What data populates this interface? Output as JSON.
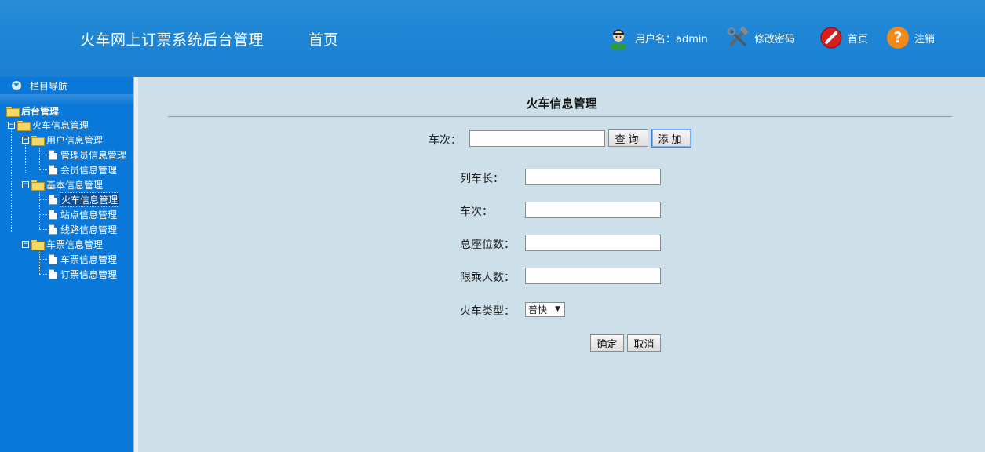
{
  "header": {
    "app_title": "火车网上订票系统后台管理",
    "home_nav": "首页",
    "user_label": "用户名：admin",
    "change_password": "修改密码",
    "home": "首页",
    "logout": "注销",
    "icons": {
      "user": "user-avatar-icon",
      "tools": "tools-icon",
      "home": "home-icon",
      "logout": "help-icon"
    }
  },
  "sidebar": {
    "nav_title": "栏目导航",
    "tree": {
      "root": "后台管理",
      "train_mgmt": "火车信息管理",
      "user_info": "用户信息管理",
      "admin_info": "管理员信息管理",
      "member_info": "会员信息管理",
      "basic_info": "基本信息管理",
      "train_info": "火车信息管理",
      "station_info": "站点信息管理",
      "route_info": "线路信息管理",
      "ticket_mgmt": "车票信息管理",
      "ticket_info": "车票信息管理",
      "order_info": "订票信息管理"
    }
  },
  "main": {
    "title": "火车信息管理",
    "search": {
      "label": "车次：",
      "value": "",
      "query_button": "查询",
      "add_button": "添加"
    },
    "form": {
      "conductor_label": "列车长：",
      "train_no_label": "车次：",
      "total_seats_label": "总座位数：",
      "capacity_label": "限乘人数：",
      "type_label": "火车类型：",
      "type_selected": "普快",
      "confirm_button": "确定",
      "cancel_button": "取消"
    }
  },
  "colors": {
    "header": "#1f86d6",
    "sidebar": "#0a78d8",
    "main_bg": "#cddfe8"
  }
}
